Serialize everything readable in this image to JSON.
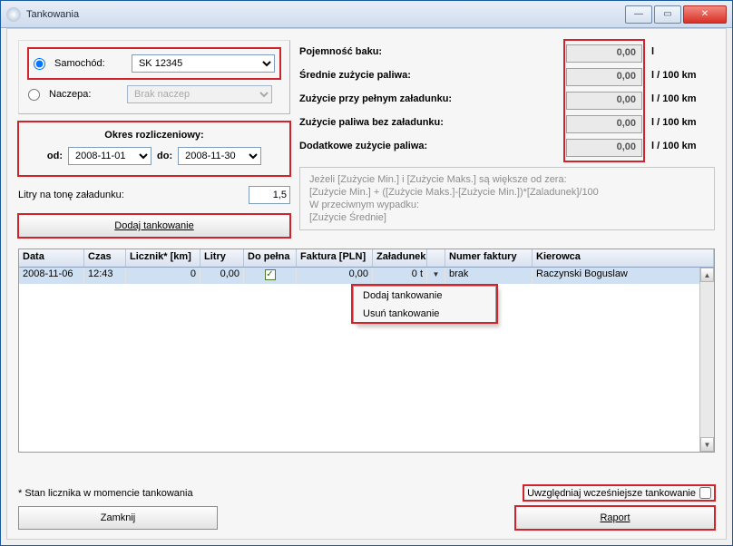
{
  "window": {
    "title": "Tankowania"
  },
  "radios": {
    "car_label": "Samochód:",
    "trailer_label": "Naczepa:"
  },
  "car_select": "SK 12345",
  "trailer_select": "Brak naczep",
  "period": {
    "title": "Okres rozliczeniowy:",
    "from_label": "od:",
    "from": "2008-11-01",
    "to_label": "do:",
    "to": "2008-11-30"
  },
  "liters_label": "Litry na tonę załadunku:",
  "liters_value": "1,5",
  "add_button": "Dodaj tankowanie",
  "stats": {
    "tank": {
      "label": "Pojemność baku:",
      "value": "0,00",
      "unit": "l"
    },
    "avg": {
      "label": "Średnie zużycie paliwa:",
      "value": "0,00",
      "unit": "l / 100 km"
    },
    "full": {
      "label": "Zużycie przy pełnym załadunku:",
      "value": "0,00",
      "unit": "l / 100 km"
    },
    "empty": {
      "label": "Zużycie paliwa bez załadunku:",
      "value": "0,00",
      "unit": "l / 100 km"
    },
    "extra": {
      "label": "Dodatkowe zużycie paliwa:",
      "value": "0,00",
      "unit": "l / 100 km"
    }
  },
  "formula": {
    "l1": "Jeżeli [Zużycie Min.] i [Zużycie Maks.] są większe od zera:",
    "l2": "  [Zużycie Min.] + ([Zużycie Maks.]-[Zużycie Min.])*[Zaladunek]/100",
    "l3": "W przeciwnym wypadku:",
    "l4": "  [Zużycie Średnie]"
  },
  "grid": {
    "headers": {
      "date": "Data",
      "time": "Czas",
      "odo": "Licznik* [km]",
      "liters": "Litry",
      "full": "Do pełna",
      "invoice_pln": "Faktura [PLN]",
      "load": "Załadunek",
      "dd": "",
      "invoice_no": "Numer faktury",
      "driver": "Kierowca"
    },
    "rows": [
      {
        "date": "2008-11-06",
        "time": "12:43",
        "odo": "0",
        "liters": "0,00",
        "full": true,
        "invoice_pln": "0,00",
        "load": "0 t",
        "invoice_no": "brak",
        "driver": "Raczynski Boguslaw"
      }
    ]
  },
  "context": {
    "add": "Dodaj tankowanie",
    "del": "Usuń tankowanie"
  },
  "footnote": "* Stan licznika w momencie tankowania",
  "close_button": "Zamknij",
  "include_prev": "Uwzględniaj wcześniejsze tankowanie",
  "report_button": "Raport"
}
